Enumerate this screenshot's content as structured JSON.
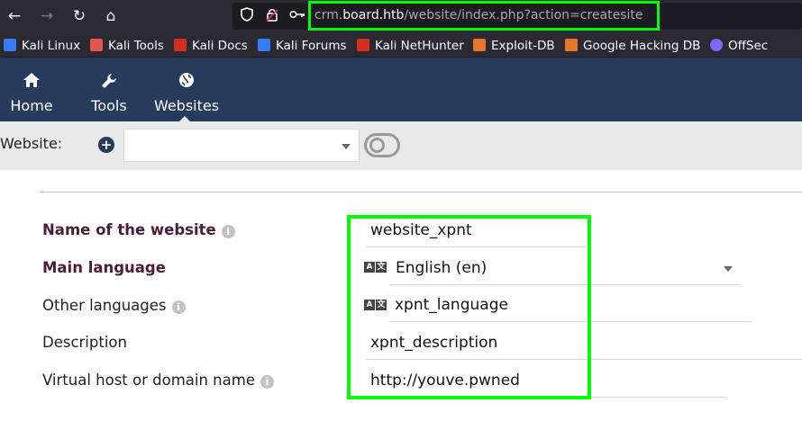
{
  "browser": {
    "url_prefix": "crm.",
    "url_host": "board.htb",
    "url_path": "/website/index.php?action=createsite",
    "nav": {
      "back_icon": "←",
      "forward_icon": "→",
      "reload_icon": "↻",
      "home_icon": "⌂"
    }
  },
  "bookmarks": [
    {
      "label": "Kali Linux",
      "color": "#367bf0"
    },
    {
      "label": "Kali Tools",
      "color": "#e2574c"
    },
    {
      "label": "Kali Docs",
      "color": "#d62d20"
    },
    {
      "label": "Kali Forums",
      "color": "#367bf0"
    },
    {
      "label": "Kali NetHunter",
      "color": "#d62d20"
    },
    {
      "label": "Exploit-DB",
      "color": "#e8742c"
    },
    {
      "label": "Google Hacking DB",
      "color": "#e8742c"
    },
    {
      "label": "OffSec",
      "color": "#7e67ff"
    }
  ],
  "topmenu": {
    "items": [
      {
        "label": "Home",
        "icon": "house-icon"
      },
      {
        "label": "Tools",
        "icon": "wrench-icon"
      },
      {
        "label": "Websites",
        "icon": "globe-icon"
      }
    ],
    "active": "Websites"
  },
  "sitebar": {
    "label": "Website:",
    "selected": ""
  },
  "form": {
    "fields": {
      "name": {
        "label": "Name of the website",
        "value": "website_xpnt"
      },
      "main_language": {
        "label": "Main language",
        "value": "English (en)"
      },
      "other_languages": {
        "label": "Other languages",
        "value": "xpnt_language"
      },
      "description": {
        "label": "Description",
        "value": "xpnt_description"
      },
      "virtual_host": {
        "label": "Virtual host or domain name",
        "value": "http://youve.pwned"
      }
    }
  },
  "colors": {
    "menu_bg": "#263c5c",
    "required_label": "#4a1d3b",
    "highlight": "#00ff00"
  }
}
